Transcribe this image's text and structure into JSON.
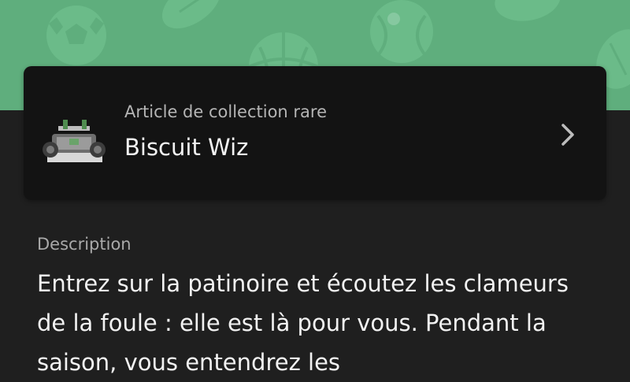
{
  "item": {
    "category": "Article de collection rare",
    "name": "Biscuit Wiz",
    "thumbnail_icon": "go-kart-trophy-icon",
    "open_icon": "chevron-right-icon"
  },
  "description": {
    "label": "Description",
    "text": "Entrez sur la patinoire et écoutez les clameurs de la foule : elle est là pour vous. Pendant la saison, vous entendrez les"
  },
  "banner": {
    "background_color": "#5fae7d",
    "pattern_icons": [
      "soccer-ball-icon",
      "football-icon",
      "basketball-icon",
      "tennis-ball-icon"
    ]
  },
  "colors": {
    "page_background": "#1f1f1f",
    "card_background": "#131313"
  }
}
